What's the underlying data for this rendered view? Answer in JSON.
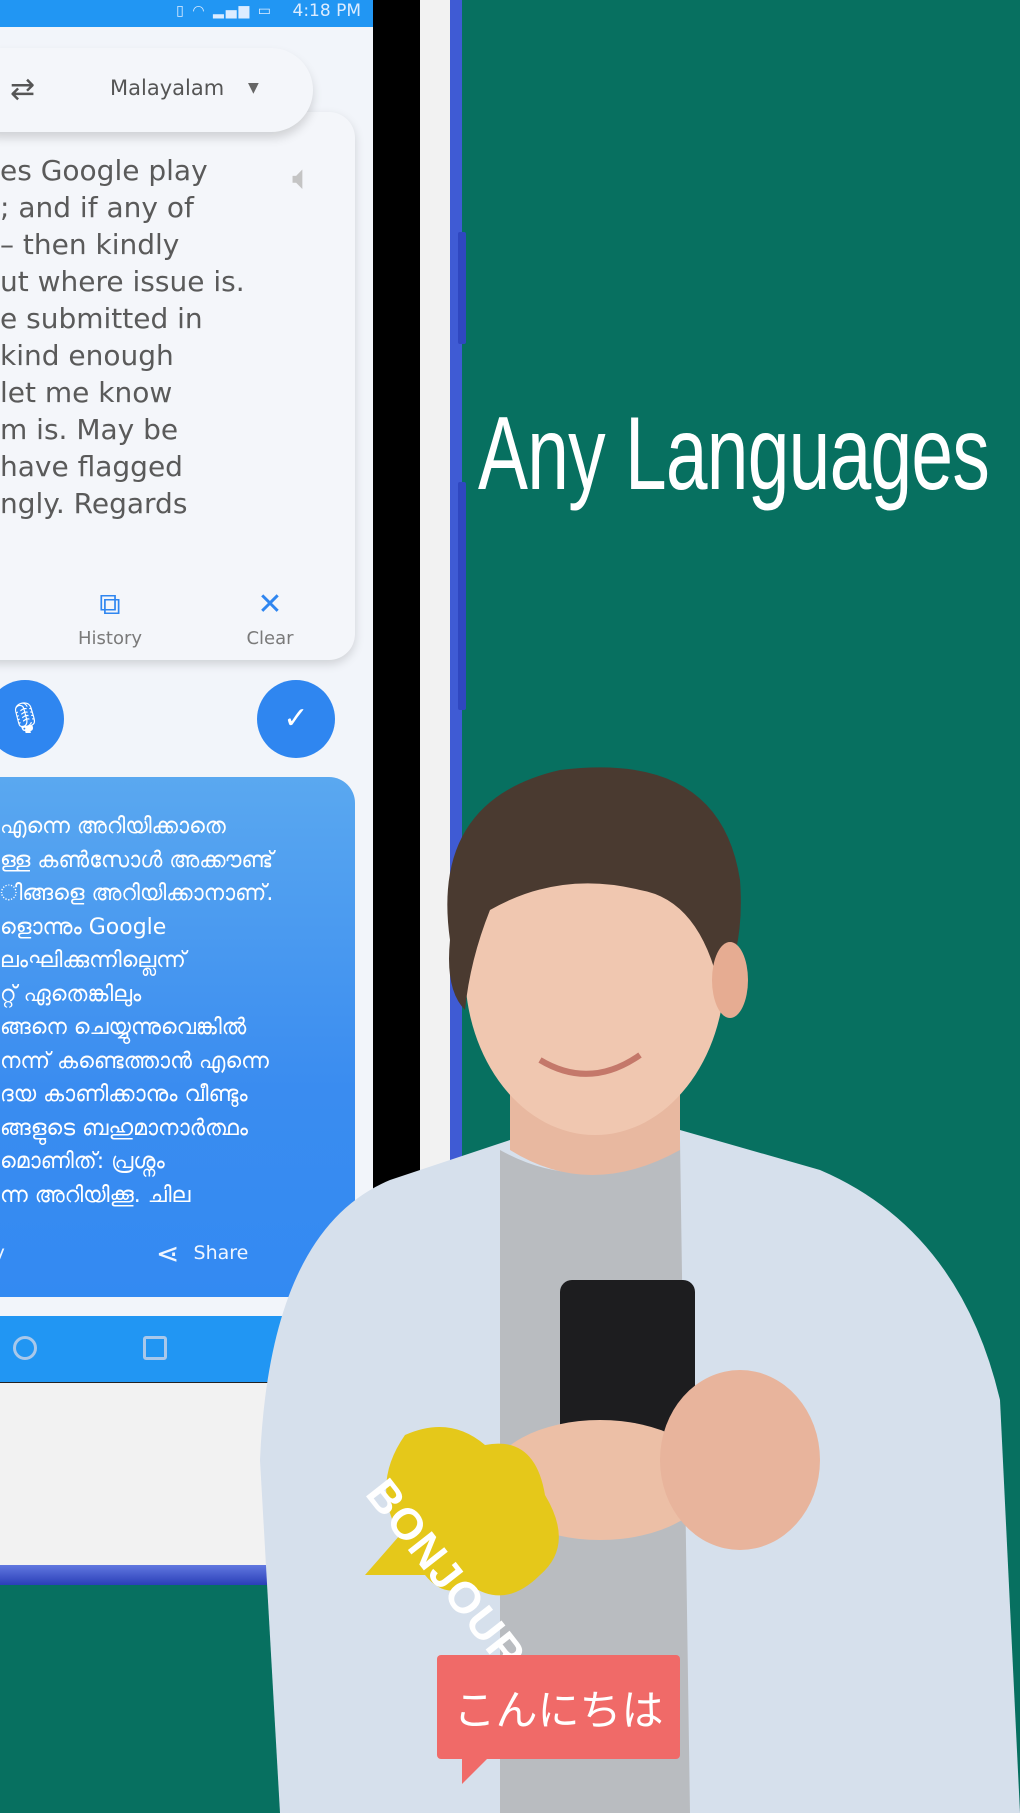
{
  "status_bar": {
    "time": "4:18 PM",
    "icons": [
      "vibrate-icon",
      "wifi-icon",
      "signal-4g-icon",
      "battery-charging-icon"
    ]
  },
  "translator": {
    "target_language": "Malayalam",
    "swap_icon": "swap-arrows-icon",
    "input_text_lines": [
      "es Google play",
      "; and if any of",
      "– then kindly",
      "ut where issue is.",
      "e submitted in",
      " kind enough",
      " let me know",
      "m is. May be",
      " have flagged",
      "ngly. Regards"
    ],
    "input_actions": [
      {
        "label": "History",
        "icon": "history-icon"
      },
      {
        "label": "Clear",
        "icon": "close-icon"
      }
    ],
    "mic_icon": "microphone-icon",
    "translate_icon": "check-icon",
    "output_text_lines": [
      " എന്നെ അറിയിക്കാതെ",
      "ള്ള കൺസോൾ അക്കൗണ്ട്",
      "ിങ്ങളെ അറിയിക്കാനാണ്.",
      "ളൊന്നും Google",
      " ലംഘിക്കുന്നില്ലെന്ന്",
      "റ്റ് ഏതെങ്കിലും",
      "ങ്ങനെ ചെയ്യുന്നുവെങ്കിൽ",
      "നന്ന് കണ്ടെത്താൻ എന്നെ",
      "ദയ കാണിക്കാനും വീണ്ടും",
      "ങ്ങളുടെ ബഹുമാനാർത്ഥം",
      "മൊണിത്: പ്രശ്നം",
      "ന്ന അറിയിക്കൂ. ചില"
    ],
    "output_actions": [
      {
        "label": "opy",
        "icon": "copy-icon"
      },
      {
        "label": "Share",
        "icon": "share-icon"
      }
    ]
  },
  "nav_bar": {
    "home_icon": "home-circle-icon",
    "recents_icon": "recents-square-icon"
  },
  "promo": {
    "headline": "Any Languages",
    "bubble_french": "BONJOUR",
    "bubble_japanese": "こんにちは",
    "colors": {
      "background": "#077060",
      "accent_blue": "#2f86f0",
      "bonjour_yellow": "#e5c81a",
      "konnichiwa_red": "#f06a68"
    }
  }
}
